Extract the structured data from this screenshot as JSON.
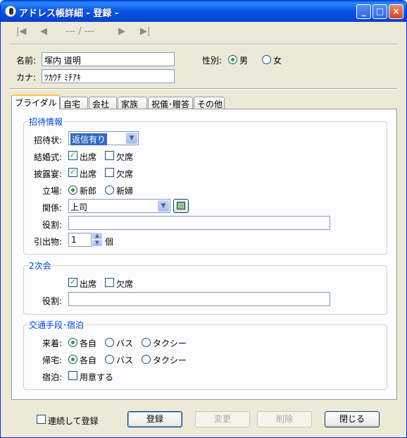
{
  "window": {
    "title": "アドレス帳詳細 - 登録 -"
  },
  "titlebar": {
    "minimize": "_",
    "maximize": "□",
    "close": "×"
  },
  "nav": {
    "first": "|◀",
    "prev": "◀",
    "position": "--- / ---",
    "next": "▶",
    "last": "▶|"
  },
  "person": {
    "name_label": "名前:",
    "name_value": "塚内 道明",
    "kana_label": "カナ:",
    "kana_value": "ﾂｶｳﾁ ﾐﾁｱｷ",
    "gender_label": "性別:",
    "gender_male": "男",
    "gender_female": "女"
  },
  "tabs": [
    "ブライダル",
    "自宅",
    "会社",
    "家族",
    "祝儀･贈答",
    "その他"
  ],
  "invite": {
    "group_title": "招待情報",
    "status_label": "招待状:",
    "status_value": "返信有り",
    "wedding_label": "結婚式:",
    "reception_label": "披露宴:",
    "attend": "出席",
    "absent": "欠席",
    "side_label": "立場:",
    "side_groom": "新郎",
    "side_bride": "新婦",
    "relation_label": "関係:",
    "relation_value": "上司",
    "role_label": "役割:",
    "role_value": "",
    "gift_label": "引出物:",
    "gift_value": "1",
    "gift_unit": "個"
  },
  "second_party": {
    "group_title": "2次会",
    "attend": "出席",
    "absent": "欠席",
    "role_label": "役割:",
    "role_value": ""
  },
  "transport": {
    "group_title": "交通手段･宿泊",
    "arrive_label": "来着:",
    "return_label": "帰宅:",
    "own": "各自",
    "bus": "バス",
    "taxi": "タクシー",
    "lodging_label": "宿泊:",
    "lodging_option": "用意する"
  },
  "footer": {
    "continuous_label": "連続して登録",
    "register": "登録",
    "modify": "変更",
    "delete": "削除",
    "close": "閉じる"
  },
  "colors": {
    "group_title": "#0046d5",
    "titlebar": "#0549da",
    "tab_highlight": "#ffc73c"
  }
}
